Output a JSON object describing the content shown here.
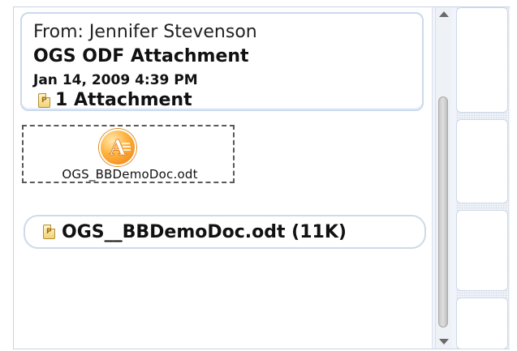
{
  "message": {
    "from": "From: Jennifer Stevenson",
    "subject": "OGS ODF Attachment",
    "date": "Jan 14, 2009 4:39 PM",
    "attachment_count": "1 Attachment"
  },
  "preview": {
    "file_name": "OGS_BBDemoDoc.odt",
    "icon": "document-app-icon"
  },
  "attachment": {
    "label": "OGS__BBDemoDoc.odt (11K)",
    "icon": "document-icon"
  },
  "colors": {
    "accent_orange": "#ffb13c",
    "border_blue": "#cbd9ea"
  }
}
